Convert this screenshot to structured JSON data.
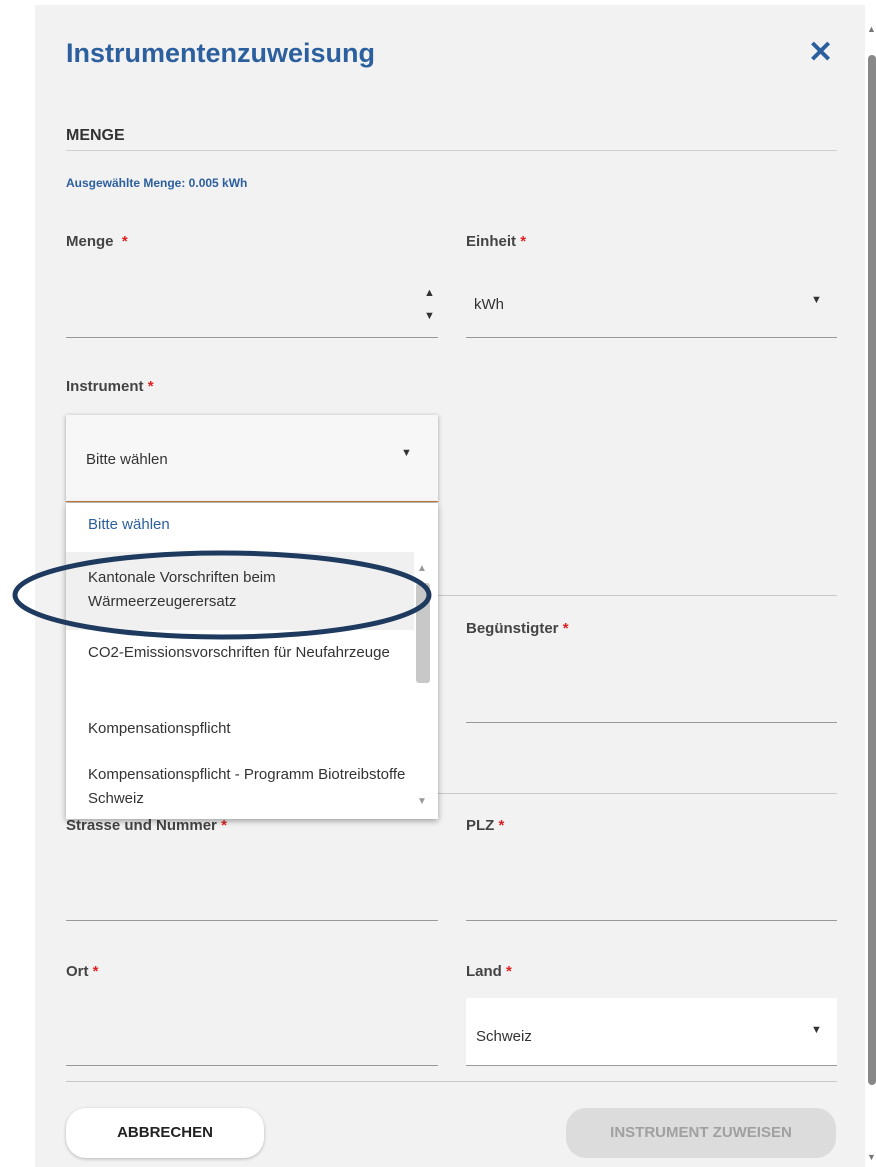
{
  "dialog": {
    "title": "Instrumentenzuweisung",
    "close_icon": "close-icon"
  },
  "section": {
    "heading": "MENGE",
    "selected_amount": "Ausgewählte Menge: 0.005 kWh"
  },
  "fields": {
    "menge_label": "Menge",
    "einheit_label": "Einheit",
    "einheit_value": "kWh",
    "instrument_label": "Instrument",
    "instrument_value": "Bitte wählen",
    "beguenstigter_label": "Begünstigter",
    "strasse_label": "Strasse und Nummer",
    "plz_label": "PLZ",
    "ort_label": "Ort",
    "land_label": "Land",
    "land_value": "Schweiz",
    "required_mark": "*"
  },
  "dropdown": {
    "options": [
      "Bitte wählen",
      "Kantonale Vorschriften beim Wärmeerzeugerersatz",
      "CO2-Emissionsvorschriften für Neufahrzeuge",
      "Kompensationspflicht",
      "Kompensationspflicht - Programm Biotreibstoffe Schweiz"
    ],
    "highlighted_index": 1,
    "highlight_color": "#1f3a5f"
  },
  "buttons": {
    "cancel": "ABBRECHEN",
    "assign": "INSTRUMENT ZUWEISEN"
  },
  "colors": {
    "accent": "#2c5f9e",
    "required": "#e02020",
    "panel_bg": "#f2f2f2"
  }
}
